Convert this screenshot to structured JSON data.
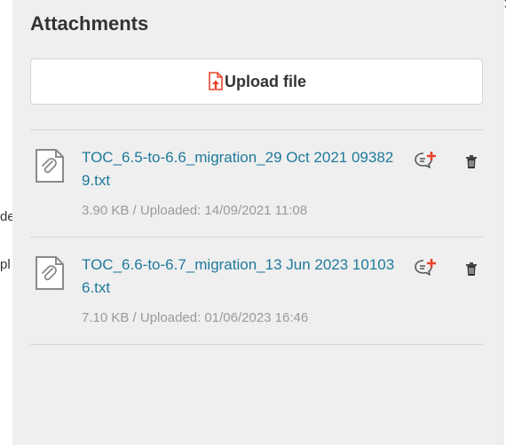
{
  "background": {
    "fragment_1": "de",
    "fragment_2": "pl",
    "close_glyph": "×"
  },
  "panel": {
    "title": "Attachments",
    "upload_button": {
      "label": "Upload file",
      "icon": "file-upload-icon"
    },
    "attachments": [
      {
        "name": "TOC_6.5-to-6.6_migration_29 Oct 2021 093829.txt",
        "meta": "3.90 KB / Uploaded: 14/09/2021 11:08",
        "icon": "attachment-file-icon"
      },
      {
        "name": "TOC_6.6-to-6.7_migration_13 Jun 2023 101036.txt",
        "meta": "7.10 KB / Uploaded: 01/06/2023 16:46",
        "icon": "attachment-file-icon"
      }
    ]
  },
  "colors": {
    "panel_bg": "#efefef",
    "link": "#1f7a9c",
    "meta": "#9a9a9a",
    "accent": "#e8442c",
    "text": "#333333"
  }
}
